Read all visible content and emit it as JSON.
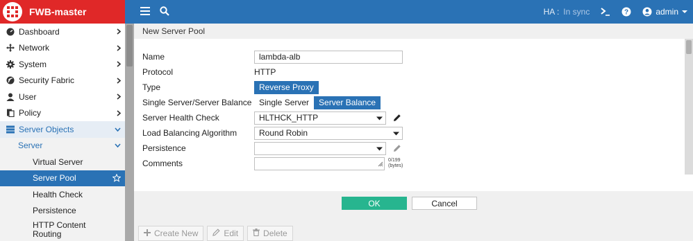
{
  "header": {
    "app_name": "FWB-master",
    "ha_label": "HA :",
    "ha_status": "In sync",
    "user": "admin"
  },
  "sidebar": {
    "items": [
      {
        "label": "Dashboard",
        "icon": "dashboard-icon"
      },
      {
        "label": "Network",
        "icon": "network-icon"
      },
      {
        "label": "System",
        "icon": "gear-icon"
      },
      {
        "label": "Security Fabric",
        "icon": "security-fabric-icon"
      },
      {
        "label": "User",
        "icon": "user-icon"
      },
      {
        "label": "Policy",
        "icon": "policy-icon"
      },
      {
        "label": "Server Objects",
        "icon": "server-icon"
      }
    ],
    "sub_group": "Server",
    "leaf_items": [
      "Virtual Server",
      "Server Pool",
      "Health Check",
      "Persistence",
      "HTTP Content Routing"
    ],
    "active_leaf": "Server Pool"
  },
  "main": {
    "title": "New Server Pool",
    "form": {
      "name_label": "Name",
      "name_value": "lambda-alb",
      "protocol_label": "Protocol",
      "protocol_value": "HTTP",
      "type_label": "Type",
      "type_value": "Reverse Proxy",
      "balance_label": "Single Server/Server Balance",
      "balance_option_single": "Single Server",
      "balance_option_balance": "Server Balance",
      "health_label": "Server Health Check",
      "health_value": "HLTHCK_HTTP",
      "lb_label": "Load Balancing Algorithm",
      "lb_value": "Round Robin",
      "persistence_label": "Persistence",
      "persistence_value": "",
      "comments_label": "Comments",
      "comments_count": "0/199",
      "comments_unit": "(bytes)"
    },
    "ok_label": "OK",
    "cancel_label": "Cancel",
    "toolbar": {
      "create_label": "Create New",
      "edit_label": "Edit",
      "delete_label": "Delete"
    }
  },
  "colors": {
    "topbar": "#2a72b5",
    "brand": "#e02828",
    "ok": "#27b58f",
    "active": "#2a72b5"
  }
}
